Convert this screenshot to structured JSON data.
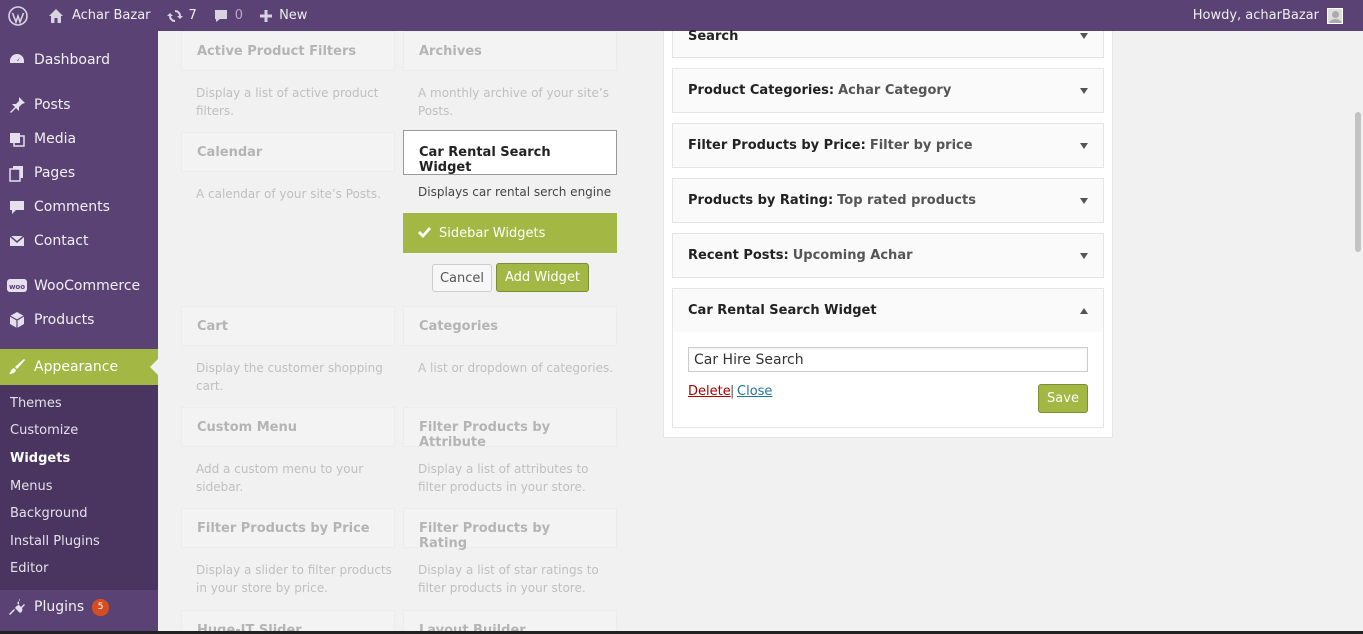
{
  "adminbar": {
    "site_name": "Achar Bazar",
    "updates_count": "7",
    "comments_count": "0",
    "new_label": "New",
    "howdy": "Howdy, acharBazar"
  },
  "sidebar": {
    "dashboard": "Dashboard",
    "posts": "Posts",
    "media": "Media",
    "pages": "Pages",
    "comments": "Comments",
    "contact": "Contact",
    "woocommerce": "WooCommerce",
    "products": "Products",
    "appearance": "Appearance",
    "plugins": "Plugins",
    "plugins_badge": "5",
    "submenu": {
      "themes": "Themes",
      "customize": "Customize",
      "widgets": "Widgets",
      "menus": "Menus",
      "background": "Background",
      "install_plugins": "Install Plugins",
      "editor": "Editor"
    }
  },
  "available_widgets": [
    {
      "name": "Active Product Filters",
      "desc": "Display a list of active product filters."
    },
    {
      "name": "Archives",
      "desc": "A monthly archive of your site’s Posts."
    },
    {
      "name": "Calendar",
      "desc": "A calendar of your site’s Posts."
    },
    {
      "name": "Cart",
      "desc": "Display the customer shopping cart."
    },
    {
      "name": "Categories",
      "desc": "A list or dropdown of categories."
    },
    {
      "name": "Custom Menu",
      "desc": "Add a custom menu to your sidebar."
    },
    {
      "name": "Filter Products by Attribute",
      "desc": "Display a list of attributes to filter products in your store."
    },
    {
      "name": "Filter Products by Price",
      "desc": "Display a slider to filter products in your store by price."
    },
    {
      "name": "Filter Products by Rating",
      "desc": "Display a list of star ratings to filter products in your store."
    },
    {
      "name": "Huge-IT Slider",
      "desc": ""
    },
    {
      "name": "Layout Builder",
      "desc": ""
    }
  ],
  "chooser": {
    "widget_title": "Car Rental Search Widget",
    "widget_desc": "Displays car rental serch engine",
    "target_sidebar": "Sidebar Widgets",
    "cancel_label": "Cancel",
    "add_label": "Add Widget"
  },
  "sidebar_widgets": [
    {
      "name": "Search",
      "title": ""
    },
    {
      "name": "Product Categories",
      "title": "Achar Category"
    },
    {
      "name": "Filter Products by Price",
      "title": "Filter by price"
    },
    {
      "name": "Products by Rating",
      "title": "Top rated products"
    },
    {
      "name": "Recent Posts",
      "title": "Upcoming Achar"
    },
    {
      "name": "Car Rental Search Widget",
      "title": ""
    }
  ],
  "open_widget": {
    "title_value": "Car Hire Search",
    "delete_label": "Delete",
    "pipe": "|",
    "close_label": "Close",
    "save_label": "Save"
  },
  "colors": {
    "admin_purple": "#5b4275",
    "accent_green": "#a3b745"
  }
}
